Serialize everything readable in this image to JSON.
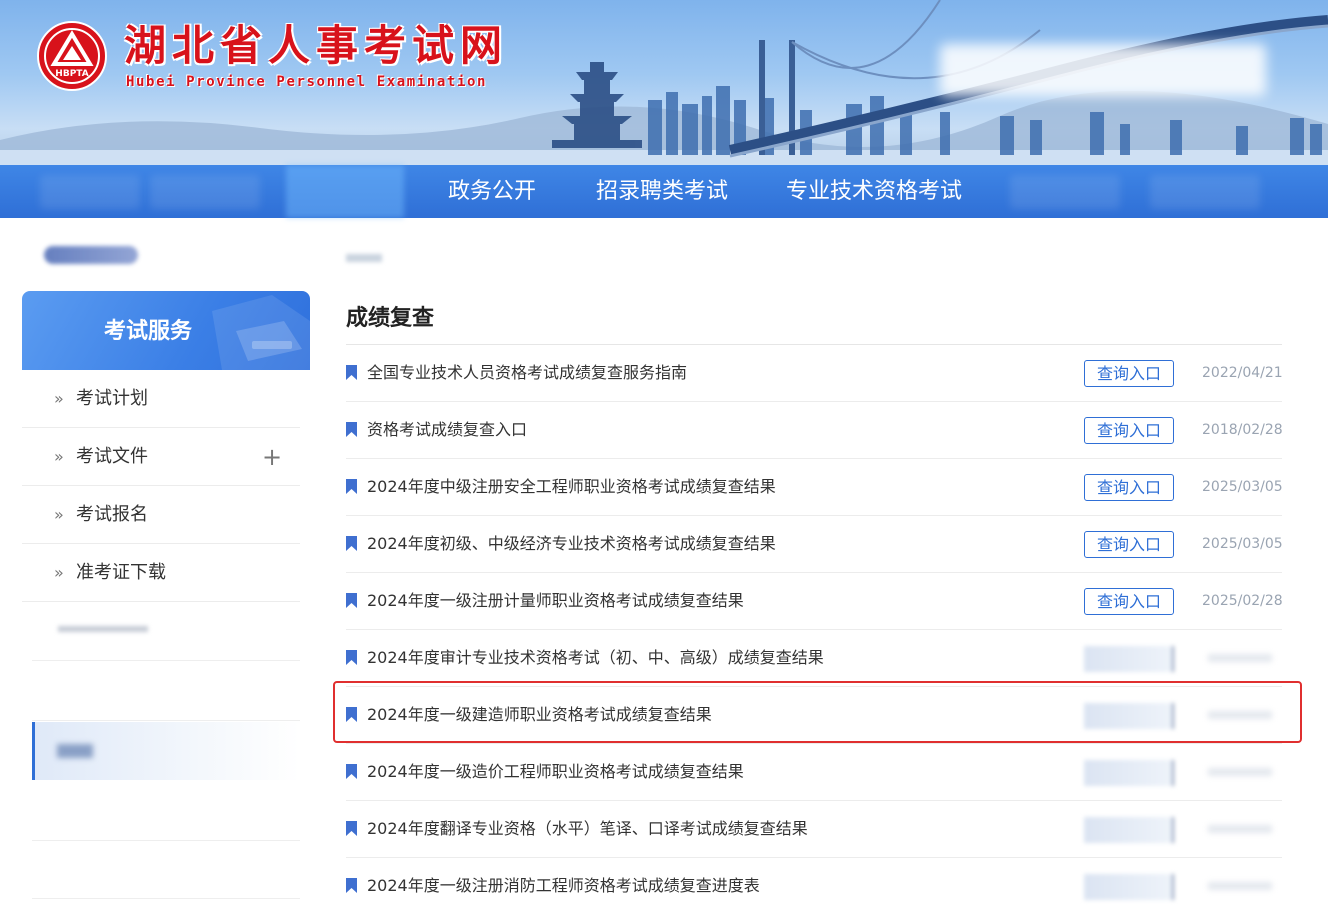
{
  "header": {
    "site_title": "湖北省人事考试网",
    "site_subtitle": "Hubei Province Personnel Examination",
    "emblem_text": "HBPTA",
    "emblem_icon": "hbpta-emblem-icon"
  },
  "nav": {
    "items": [
      {
        "label": "政务公开"
      },
      {
        "label": "招录聘类考试"
      },
      {
        "label": "专业技术资格考试"
      }
    ]
  },
  "sidebar": {
    "heading": "考试服务",
    "arrow_glyph": "»",
    "expand_glyph": "+",
    "items": [
      {
        "label": "考试计划",
        "expandable": false
      },
      {
        "label": "考试文件",
        "expandable": true
      },
      {
        "label": "考试报名",
        "expandable": false
      },
      {
        "label": "准考证下载",
        "expandable": false
      }
    ]
  },
  "main": {
    "section_title": "成绩复查",
    "query_label": "查询入口",
    "flag_icon": "bookmark-flag-icon",
    "accent_color": "#2f6fd6",
    "highlight_color": "#e02f2f",
    "rows": [
      {
        "title": "全国专业技术人员资格考试成绩复查服务指南",
        "date": "2022/04/21"
      },
      {
        "title": "资格考试成绩复查入口",
        "date": "2018/02/28"
      },
      {
        "title": "2024年度中级注册安全工程师职业资格考试成绩复查结果",
        "date": "2025/03/05"
      },
      {
        "title": "2024年度初级、中级经济专业技术资格考试成绩复查结果",
        "date": "2025/03/05"
      },
      {
        "title": "2024年度一级注册计量师职业资格考试成绩复查结果",
        "date": "2025/02/28"
      },
      {
        "title": "2024年度审计专业技术资格考试（初、中、高级）成绩复查结果"
      },
      {
        "title": "2024年度一级建造师职业资格考试成绩复查结果",
        "highlighted": true
      },
      {
        "title": "2024年度一级造价工程师职业资格考试成绩复查结果"
      },
      {
        "title": "2024年度翻译专业资格（水平）笔译、口译考试成绩复查结果"
      },
      {
        "title": "2024年度一级注册消防工程师资格考试成绩复查进度表"
      }
    ]
  }
}
